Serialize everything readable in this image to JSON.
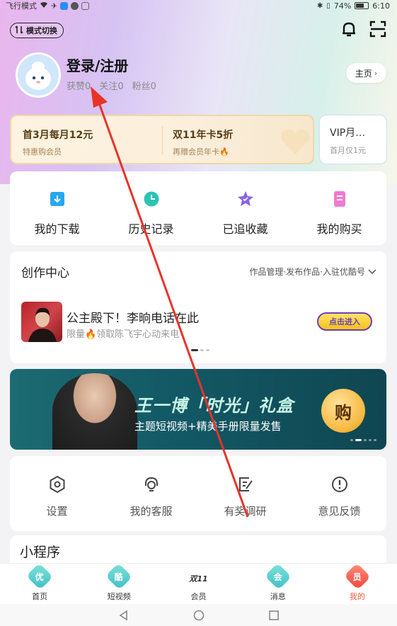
{
  "status_bar": {
    "left_text": "飞行模式",
    "battery_text": "74%",
    "time": "6:10"
  },
  "header": {
    "mode_switch_label": "模式切换",
    "username": "登录/注册",
    "stats": [
      {
        "label": "获赞",
        "value": "0"
      },
      {
        "label": "关注",
        "value": "0"
      },
      {
        "label": "粉丝",
        "value": "0"
      }
    ],
    "home_button_label": "主页"
  },
  "vip": {
    "offer1_title": "首3月每月12元",
    "offer1_sub": "特惠购会员",
    "offer2_title": "双11年卡5折",
    "offer2_sub": "再赠会员年卡🔥",
    "offer3_title": "VIP月…",
    "offer3_sub": "首月仅1元"
  },
  "quick_actions": [
    {
      "label": "我的下载",
      "icon": "download-icon"
    },
    {
      "label": "历史记录",
      "icon": "history-icon"
    },
    {
      "label": "已追收藏",
      "icon": "favorite-icon"
    },
    {
      "label": "我的购买",
      "icon": "purchase-icon"
    }
  ],
  "creator": {
    "title": "创作中心",
    "links": "作品管理·发布作品·入驻优酷号",
    "headline": "公主殿下！李晌电话在此",
    "subline": "限量🔥领取陈飞宇心动来电",
    "enter_label": "点击进入"
  },
  "banner": {
    "title": "王一博「时光」礼盒",
    "subtitle": "主题短视频+精美手册限量发售",
    "button_label": "购"
  },
  "tools": [
    {
      "label": "设置",
      "icon": "settings-icon"
    },
    {
      "label": "我的客服",
      "icon": "customer-service-icon"
    },
    {
      "label": "有奖调研",
      "icon": "survey-icon"
    },
    {
      "label": "意见反馈",
      "icon": "feedback-icon"
    }
  ],
  "mini_programs": {
    "title": "小程序"
  },
  "tabbar": {
    "items": [
      {
        "label": "首页",
        "badge": "优"
      },
      {
        "label": "短视频",
        "badge": "酷"
      },
      {
        "label": "会员",
        "badge": "双11"
      },
      {
        "label": "消息",
        "badge": "会"
      },
      {
        "label": "我的",
        "badge": "员"
      }
    ],
    "active_index": 4
  },
  "colors": {
    "accent": "#e8593a",
    "annotation_arrow": "#e8332a",
    "teal": "#3fbfc7"
  }
}
